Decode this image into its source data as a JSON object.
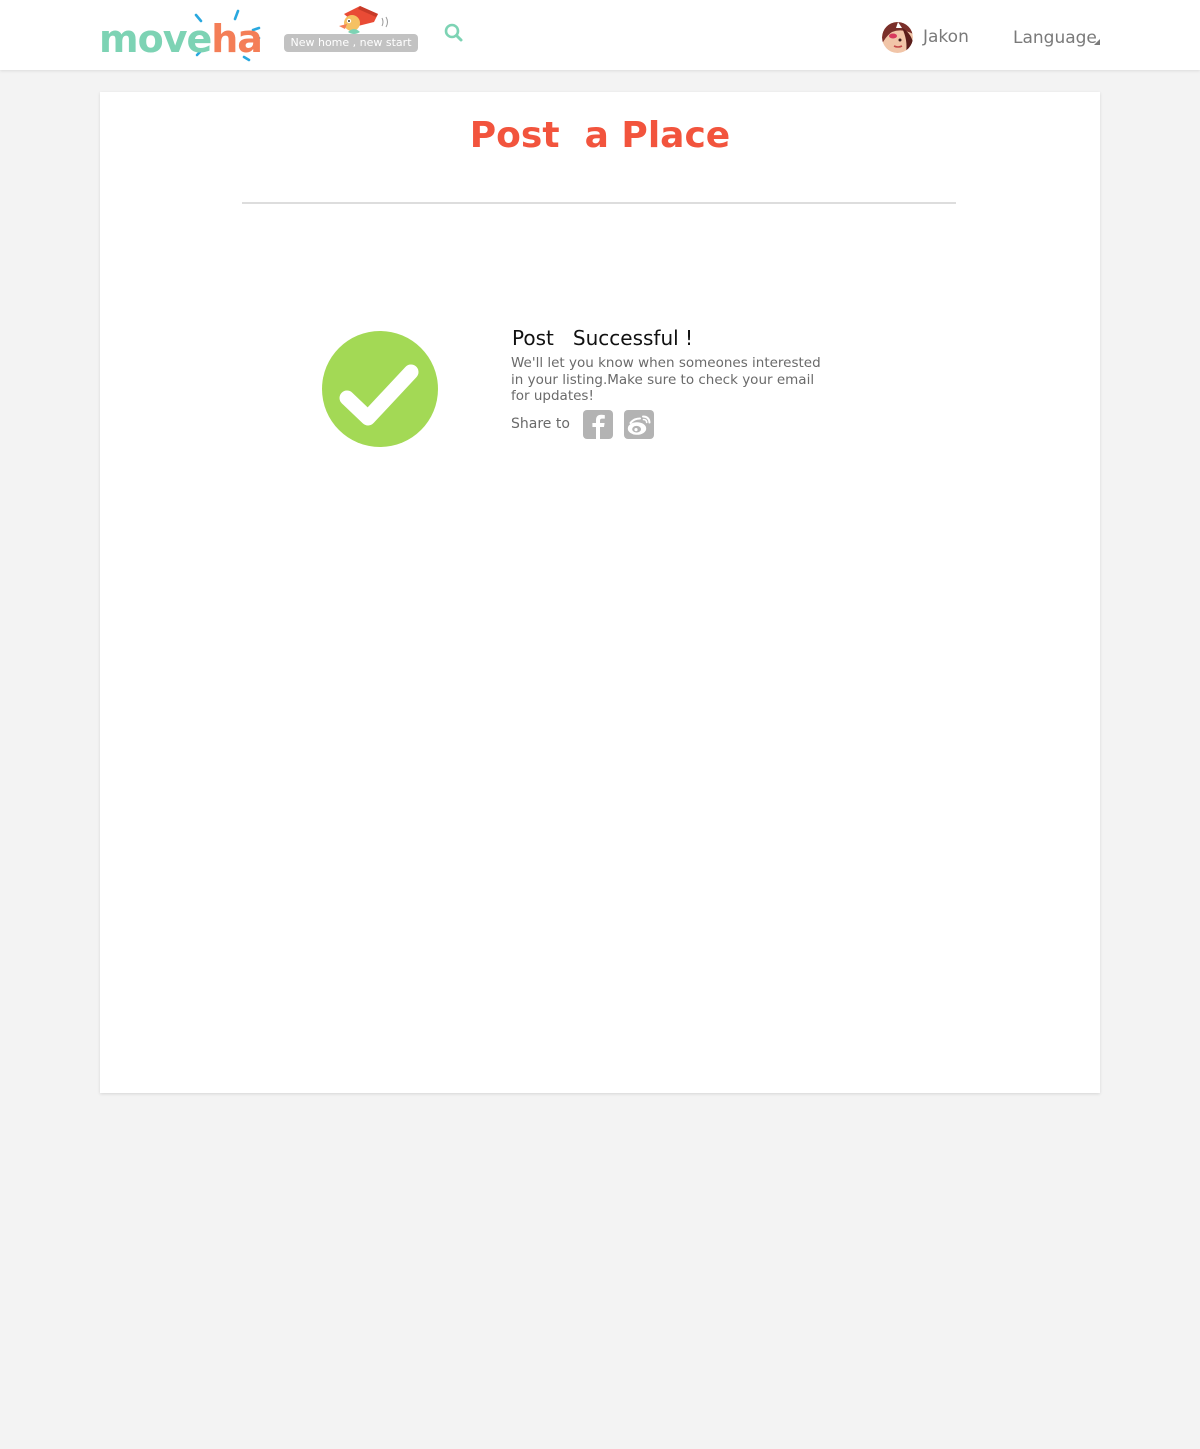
{
  "header": {
    "logo": {
      "part1": "move",
      "part2": "ha"
    },
    "tagline": "New home , new start",
    "search_icon": "search-icon",
    "user": {
      "name": "Jakon",
      "avatar_icon": "avatar"
    },
    "language_label": "Language"
  },
  "main": {
    "title": "Post  a Place",
    "success_title": "Post   Successful !",
    "success_message": "We'll let you know when someones interested in your listing.Make sure to check your email for updates!",
    "share_label": "Share to",
    "share_buttons": [
      {
        "name": "facebook",
        "icon": "facebook-icon"
      },
      {
        "name": "weibo",
        "icon": "weibo-icon"
      }
    ]
  },
  "colors": {
    "logo_green": "#7dd3b4",
    "logo_orange": "#f47e57",
    "logo_rays": "#29a8df",
    "title_red": "#f2543d",
    "success_green": "#a3d955",
    "share_gray": "#b3b3b3",
    "page_bg": "#f3f3f3"
  }
}
